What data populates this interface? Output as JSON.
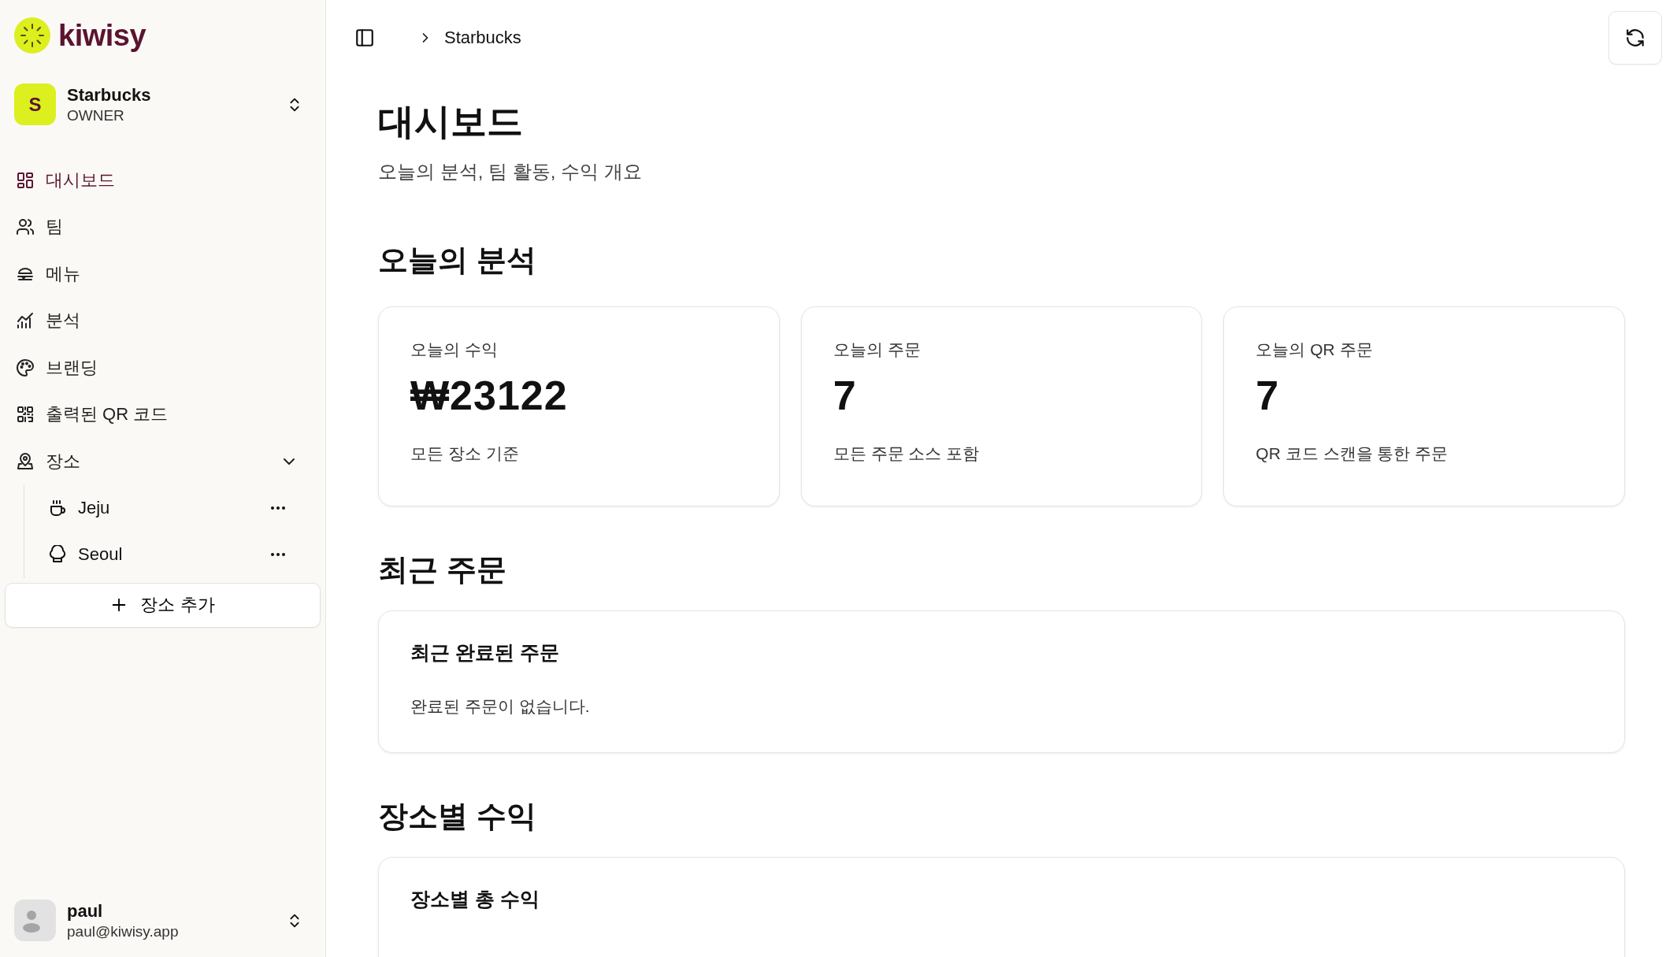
{
  "logo": {
    "text": "kiwisy"
  },
  "org": {
    "initial": "S",
    "name": "Starbucks",
    "role": "OWNER"
  },
  "nav": [
    {
      "label": "대시보드",
      "selected": true
    },
    {
      "label": "팀",
      "selected": false
    },
    {
      "label": "메뉴",
      "selected": false
    },
    {
      "label": "분석",
      "selected": false
    },
    {
      "label": "브랜딩",
      "selected": false
    },
    {
      "label": "출력된 QR 코드",
      "selected": false
    },
    {
      "label": "장소",
      "selected": false,
      "expanded": true,
      "children": [
        {
          "label": "Jeju",
          "selected": false
        },
        {
          "label": "Seoul",
          "selected": false
        }
      ]
    }
  ],
  "add_location": {
    "label": "장소 추가"
  },
  "user": {
    "name": "paul",
    "email": "paul@kiwisy.app"
  },
  "breadcrumb": [
    "Starbucks"
  ],
  "page": {
    "title": "대시보드",
    "subtitle": "오늘의 분석, 팀 활동, 수익 개요"
  },
  "sections": [
    {
      "heading": "오늘의 분석",
      "kind": "stats",
      "cards": [
        {
          "label": "오늘의 수익",
          "value": "₩23122",
          "note": "모든 장소 기준"
        },
        {
          "label": "오늘의 주문",
          "value": "7",
          "note": "모든 주문 소스 포함"
        },
        {
          "label": "오늘의 QR 주문",
          "value": "7",
          "note": "QR 코드 스캔을 통한 주문"
        }
      ]
    },
    {
      "heading": "최근 주문",
      "kind": "panel",
      "title": "최근 완료된 주문",
      "text": "완료된 주문이 없습니다."
    },
    {
      "heading": "장소별 수익",
      "kind": "panel",
      "title": "장소별 총 수익"
    }
  ]
}
